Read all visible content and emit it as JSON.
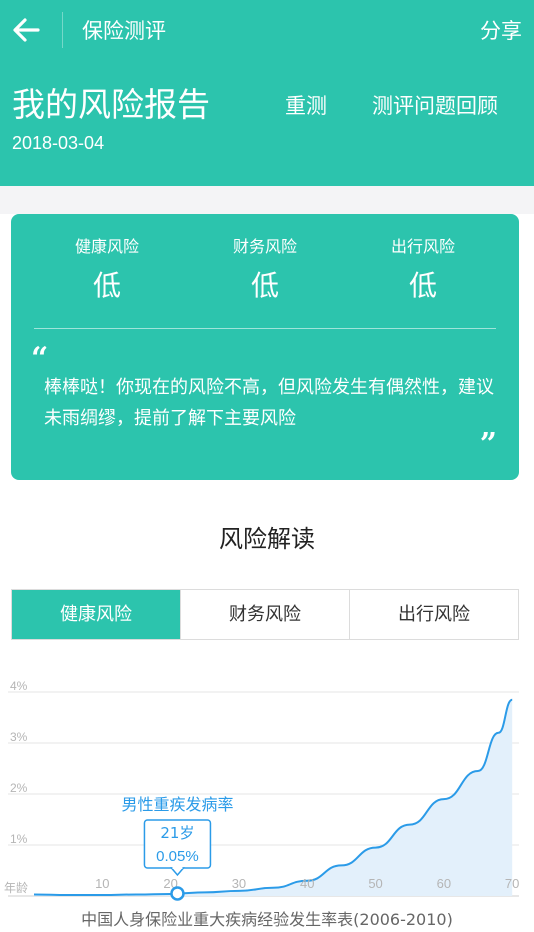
{
  "header": {
    "nav_title": "保险测评",
    "share_label": "分享",
    "report_title": "我的风险报告",
    "report_date": "2018-03-04",
    "retest_label": "重测",
    "review_label": "测评问题回顾",
    "back_icon": "back-arrow-icon"
  },
  "summary": {
    "risks": [
      {
        "name": "健康风险",
        "level": "低"
      },
      {
        "name": "财务风险",
        "level": "低"
      },
      {
        "name": "出行风险",
        "level": "低"
      }
    ],
    "quote_open": "“",
    "quote_close": "”",
    "quote_text": "棒棒哒！你现在的风险不高，但风险发生有偶然性，建议未雨绸缪，提前了解下主要风险"
  },
  "section_title": "风险解读",
  "tabs": [
    {
      "label": "健康风险",
      "active": true
    },
    {
      "label": "财务风险",
      "active": false
    },
    {
      "label": "出行风险",
      "active": false
    }
  ],
  "chart_data": {
    "type": "area",
    "series": [
      {
        "name": "男性重疾发病率",
        "x": [
          0,
          5,
          10,
          15,
          20,
          21,
          25,
          30,
          35,
          40,
          45,
          50,
          55,
          60,
          65,
          68,
          70
        ],
        "y": [
          0.03,
          0.02,
          0.02,
          0.03,
          0.04,
          0.05,
          0.07,
          0.1,
          0.16,
          0.3,
          0.6,
          0.95,
          1.4,
          1.9,
          2.45,
          3.2,
          3.85
        ]
      }
    ],
    "x_axis_label": "年龄",
    "x_ticks": [
      "10",
      "20",
      "30",
      "40",
      "50",
      "60",
      "70"
    ],
    "x_tick_values": [
      10,
      20,
      30,
      40,
      50,
      60,
      70
    ],
    "y_ticks": [
      "1%",
      "2%",
      "3%",
      "4%"
    ],
    "y_tick_values": [
      1,
      2,
      3,
      4
    ],
    "xlim": [
      0,
      71
    ],
    "ylim": [
      0,
      4
    ],
    "highlight": {
      "x": 21,
      "y": 0.05,
      "age_label": "21岁",
      "value_label": "0.05%"
    },
    "grid": true,
    "colors": {
      "line": "#2b9be8",
      "fill": "#e3f0fb",
      "grid": "#e6e6e6",
      "label": "#2b9be8",
      "tick": "#b5b5b5"
    }
  },
  "source_note": "中国人身保险业重大疾病经验发生率表(2006-2010)",
  "colors": {
    "brand": "#2cc4ad",
    "background_gap": "#f4f4f6"
  }
}
